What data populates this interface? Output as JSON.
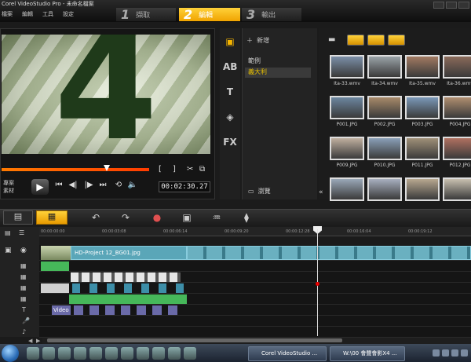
{
  "app": {
    "title": "Corel VideoStudio Pro - 未命名檔案",
    "menu": [
      "檔案",
      "編輯",
      "工具",
      "設定"
    ]
  },
  "steps": [
    {
      "num": "1",
      "label": "擷取",
      "active": false
    },
    {
      "num": "2",
      "label": "編輯",
      "active": true
    },
    {
      "num": "3",
      "label": "輸出",
      "active": false
    }
  ],
  "preview": {
    "frame_text": "4",
    "mode_label": "專案\n素材",
    "timecode": "00:02:30.27",
    "position_fraction": 0.69
  },
  "library": {
    "add_label": "新增",
    "folders": [
      {
        "label": "範例",
        "selected": false
      },
      {
        "label": "義大利",
        "selected": true
      }
    ],
    "browse_label": "瀏覽",
    "thumbnails": [
      {
        "caption": "Ita-33.wmv",
        "color": "#7b8fa8"
      },
      {
        "caption": "Ita-34.wmv",
        "color": "#9aa3a8"
      },
      {
        "caption": "Ita-35.wmv",
        "color": "#a27a62"
      },
      {
        "caption": "Ita-36.wmv",
        "color": "#8a6a5a"
      },
      {
        "caption": "P001.JPG",
        "color": "#6c86a0"
      },
      {
        "caption": "P002.JPG",
        "color": "#a88a6a"
      },
      {
        "caption": "P003.JPG",
        "color": "#7a98b8"
      },
      {
        "caption": "P004.JPG",
        "color": "#b08e70"
      },
      {
        "caption": "P009.JPG",
        "color": "#c0b0a0"
      },
      {
        "caption": "P010.JPG",
        "color": "#8aa0b8"
      },
      {
        "caption": "P011.JPG",
        "color": "#a09078"
      },
      {
        "caption": "P012.JPG",
        "color": "#b07060"
      },
      {
        "caption": "",
        "color": "#9aa8b8"
      },
      {
        "caption": "",
        "color": "#a8b0c0"
      },
      {
        "caption": "",
        "color": "#b8a890"
      },
      {
        "caption": "",
        "color": "#c8c0b0"
      }
    ]
  },
  "timeline": {
    "ticks": [
      "00:00:00:00",
      "00:00:03:08",
      "00:00:06:14",
      "00:00:09:20",
      "00:00:12:28",
      "00:00:16:04",
      "00:00:19:12"
    ],
    "video_clip_label": "HD-Project 12_BG01.jpg",
    "title_clip_label": "Video",
    "playhead_fraction": 0.64
  },
  "taskbar": {
    "buttons": [
      {
        "label": "Corel VideoStudio ..."
      },
      {
        "label": "W:\\00 會聲會影X4 ..."
      }
    ]
  },
  "colors": {
    "accent": "#f5b400",
    "video_clip": "#5aa6b8",
    "audio_clip": "#46b85a",
    "overlay_clip": "#3d8ea8",
    "title_clip": "#6a6aa8"
  }
}
